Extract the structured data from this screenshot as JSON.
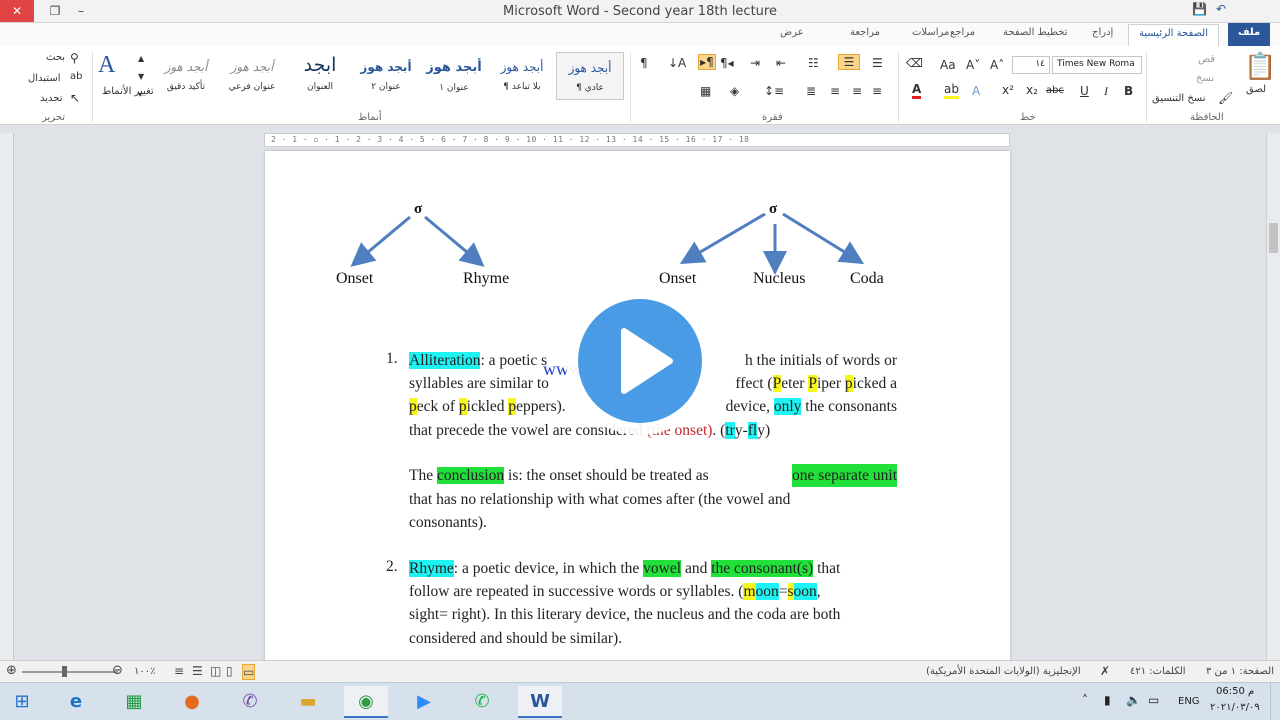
{
  "window": {
    "title": "Microsoft Word - Second year 18th lecture"
  },
  "tabs": {
    "file": "ملف",
    "home": "الصفحة الرئيسية",
    "insert": "إدراج",
    "layout": "تخطيط الصفحة",
    "references": "مراجع",
    "mailings": "مراسلات",
    "review": "مراجعة",
    "view": "عرض"
  },
  "ribbon": {
    "clipboard": {
      "label": "الحافظة",
      "paste": "لصق",
      "cut": "قص",
      "copy": "نسخ",
      "format_painter": "نسخ التنسيق"
    },
    "font": {
      "label": "خط",
      "name": "Times New Roma",
      "size": "١٤"
    },
    "paragraph": {
      "label": "فقرة"
    },
    "styles": {
      "label": "أنماط",
      "change_styles": "تغيير الأنماط",
      "preview": "أبجد هوز",
      "items": [
        {
          "preview": "أبجد هوز",
          "name": "¶ عادي"
        },
        {
          "preview": "أبجد هوز",
          "name": "¶ بلا تباعد"
        },
        {
          "preview": "أبجد هوز",
          "name": "عنوان ١"
        },
        {
          "preview": "أبجد هوز",
          "name": "عنوان ٢"
        },
        {
          "preview": "ابجد",
          "name": "العنوان"
        },
        {
          "preview": "أبجد هوز",
          "name": "عنوان فرعي"
        },
        {
          "preview": "أبجد هوز",
          "name": "تأكيد دقيق"
        }
      ]
    },
    "editing": {
      "label": "تحرير",
      "find": "بحث",
      "replace": "استبدال",
      "select": "تحديد"
    }
  },
  "ruler": {
    "text": "2 · 1 · ⌂ · 1 · 2 · 3 · 4 · 5 · 6 · 7 · 8 · 9 · 10 · 11 · 12 · 13 · 14 · 15 · 16 · 17 · 18"
  },
  "document": {
    "sigma": "σ",
    "tree1": {
      "onset": "Onset",
      "rhyme": "Rhyme"
    },
    "tree2": {
      "onset": "Onset",
      "nucleus": "Nucleus",
      "coda": "Coda"
    },
    "item1": {
      "num": "1.",
      "term": "Alliteration",
      "l1_rest": ": a poetic s",
      "l1_end": "h the initials of words or",
      "l2_a": "syllables are similar to",
      "l2_b": "ffect (",
      "l2_P1": "P",
      "l2_c": "eter ",
      "l2_P2": "P",
      "l2_d": "iper ",
      "l2_p3": "p",
      "l2_e": "icked a",
      "l3_p1": "p",
      "l3_a": "eck of ",
      "l3_p2": "p",
      "l3_b": "ickled ",
      "l3_p3": "p",
      "l3_c": "eppers).",
      "l3_d": "device, ",
      "l3_only": "only",
      "l3_e": " the consonants",
      "l4_a": "that precede the vowel are considered ",
      "l4_red": "(the onset)",
      "l4_b": ". (",
      "l4_tr": "tr",
      "l4_c": "y-",
      "l4_fl": "fl",
      "l4_d": "y)"
    },
    "conclusion": {
      "the": "The ",
      "word": "conclusion",
      "mid": " is: the onset should be treated as ",
      "unit": "one separate unit",
      "l2": "that has no relationship with what comes after (the vowel and",
      "l3": "consonants)."
    },
    "item2": {
      "num": "2.",
      "term": "Rhyme",
      "a": ": a poetic device, in which the ",
      "vowel": "vowel",
      "and": " and ",
      "cons": "the consonant(s)",
      "that": " that",
      "l2_a": "follow are repeated in successive words or syllables. (",
      "l2_m": "m",
      "l2_oon1": "oon",
      "l2_eq": "=",
      "l2_s": "s",
      "l2_oon2": "oon",
      "l2_end": ",",
      "l3": "sight= right). In this literary device, the nucleus and the coda are both",
      "l4": "considered and should be similar)."
    },
    "watermark": "www                    net"
  },
  "statusbar": {
    "page": "الصفحة: ١ من ٣",
    "words": "الكلمات: ٤٢١",
    "language": "الإنجليزية (الولايات المتحدة الأمريكية)",
    "zoom": "١٠٠٪"
  },
  "taskbar": {
    "lang": "ENG",
    "time": "06:50 م",
    "date": "٢٠٢١/٠٣/٠٩"
  }
}
